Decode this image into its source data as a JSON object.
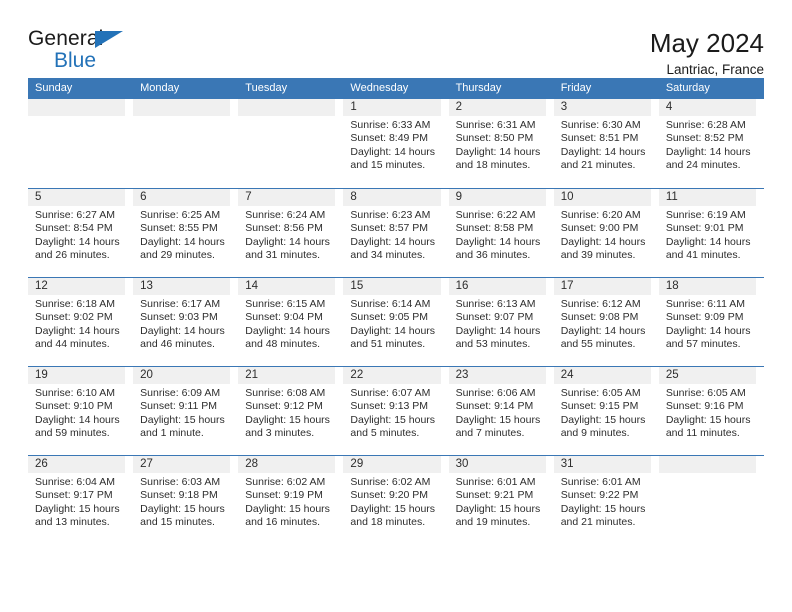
{
  "brand": {
    "name_top": "General",
    "name_bottom": "Blue",
    "accent_color": "#2372b8",
    "triangle_icon": "triangle-right-icon"
  },
  "header": {
    "title": "May 2024",
    "location": "Lantriac, France"
  },
  "calendar": {
    "header_color": "#3a77b5",
    "day_band_color": "#f0f0f0",
    "weekdays": [
      "Sunday",
      "Monday",
      "Tuesday",
      "Wednesday",
      "Thursday",
      "Friday",
      "Saturday"
    ],
    "weeks": [
      [
        {
          "day": "",
          "empty": true,
          "sunrise": "",
          "sunset": "",
          "daylight": ""
        },
        {
          "day": "",
          "empty": true,
          "sunrise": "",
          "sunset": "",
          "daylight": ""
        },
        {
          "day": "",
          "empty": true,
          "sunrise": "",
          "sunset": "",
          "daylight": ""
        },
        {
          "day": "1",
          "sunrise": "Sunrise: 6:33 AM",
          "sunset": "Sunset: 8:49 PM",
          "daylight": "Daylight: 14 hours and 15 minutes."
        },
        {
          "day": "2",
          "sunrise": "Sunrise: 6:31 AM",
          "sunset": "Sunset: 8:50 PM",
          "daylight": "Daylight: 14 hours and 18 minutes."
        },
        {
          "day": "3",
          "sunrise": "Sunrise: 6:30 AM",
          "sunset": "Sunset: 8:51 PM",
          "daylight": "Daylight: 14 hours and 21 minutes."
        },
        {
          "day": "4",
          "sunrise": "Sunrise: 6:28 AM",
          "sunset": "Sunset: 8:52 PM",
          "daylight": "Daylight: 14 hours and 24 minutes."
        }
      ],
      [
        {
          "day": "5",
          "sunrise": "Sunrise: 6:27 AM",
          "sunset": "Sunset: 8:54 PM",
          "daylight": "Daylight: 14 hours and 26 minutes."
        },
        {
          "day": "6",
          "sunrise": "Sunrise: 6:25 AM",
          "sunset": "Sunset: 8:55 PM",
          "daylight": "Daylight: 14 hours and 29 minutes."
        },
        {
          "day": "7",
          "sunrise": "Sunrise: 6:24 AM",
          "sunset": "Sunset: 8:56 PM",
          "daylight": "Daylight: 14 hours and 31 minutes."
        },
        {
          "day": "8",
          "sunrise": "Sunrise: 6:23 AM",
          "sunset": "Sunset: 8:57 PM",
          "daylight": "Daylight: 14 hours and 34 minutes."
        },
        {
          "day": "9",
          "sunrise": "Sunrise: 6:22 AM",
          "sunset": "Sunset: 8:58 PM",
          "daylight": "Daylight: 14 hours and 36 minutes."
        },
        {
          "day": "10",
          "sunrise": "Sunrise: 6:20 AM",
          "sunset": "Sunset: 9:00 PM",
          "daylight": "Daylight: 14 hours and 39 minutes."
        },
        {
          "day": "11",
          "sunrise": "Sunrise: 6:19 AM",
          "sunset": "Sunset: 9:01 PM",
          "daylight": "Daylight: 14 hours and 41 minutes."
        }
      ],
      [
        {
          "day": "12",
          "sunrise": "Sunrise: 6:18 AM",
          "sunset": "Sunset: 9:02 PM",
          "daylight": "Daylight: 14 hours and 44 minutes."
        },
        {
          "day": "13",
          "sunrise": "Sunrise: 6:17 AM",
          "sunset": "Sunset: 9:03 PM",
          "daylight": "Daylight: 14 hours and 46 minutes."
        },
        {
          "day": "14",
          "sunrise": "Sunrise: 6:15 AM",
          "sunset": "Sunset: 9:04 PM",
          "daylight": "Daylight: 14 hours and 48 minutes."
        },
        {
          "day": "15",
          "sunrise": "Sunrise: 6:14 AM",
          "sunset": "Sunset: 9:05 PM",
          "daylight": "Daylight: 14 hours and 51 minutes."
        },
        {
          "day": "16",
          "sunrise": "Sunrise: 6:13 AM",
          "sunset": "Sunset: 9:07 PM",
          "daylight": "Daylight: 14 hours and 53 minutes."
        },
        {
          "day": "17",
          "sunrise": "Sunrise: 6:12 AM",
          "sunset": "Sunset: 9:08 PM",
          "daylight": "Daylight: 14 hours and 55 minutes."
        },
        {
          "day": "18",
          "sunrise": "Sunrise: 6:11 AM",
          "sunset": "Sunset: 9:09 PM",
          "daylight": "Daylight: 14 hours and 57 minutes."
        }
      ],
      [
        {
          "day": "19",
          "sunrise": "Sunrise: 6:10 AM",
          "sunset": "Sunset: 9:10 PM",
          "daylight": "Daylight: 14 hours and 59 minutes."
        },
        {
          "day": "20",
          "sunrise": "Sunrise: 6:09 AM",
          "sunset": "Sunset: 9:11 PM",
          "daylight": "Daylight: 15 hours and 1 minute."
        },
        {
          "day": "21",
          "sunrise": "Sunrise: 6:08 AM",
          "sunset": "Sunset: 9:12 PM",
          "daylight": "Daylight: 15 hours and 3 minutes."
        },
        {
          "day": "22",
          "sunrise": "Sunrise: 6:07 AM",
          "sunset": "Sunset: 9:13 PM",
          "daylight": "Daylight: 15 hours and 5 minutes."
        },
        {
          "day": "23",
          "sunrise": "Sunrise: 6:06 AM",
          "sunset": "Sunset: 9:14 PM",
          "daylight": "Daylight: 15 hours and 7 minutes."
        },
        {
          "day": "24",
          "sunrise": "Sunrise: 6:05 AM",
          "sunset": "Sunset: 9:15 PM",
          "daylight": "Daylight: 15 hours and 9 minutes."
        },
        {
          "day": "25",
          "sunrise": "Sunrise: 6:05 AM",
          "sunset": "Sunset: 9:16 PM",
          "daylight": "Daylight: 15 hours and 11 minutes."
        }
      ],
      [
        {
          "day": "26",
          "sunrise": "Sunrise: 6:04 AM",
          "sunset": "Sunset: 9:17 PM",
          "daylight": "Daylight: 15 hours and 13 minutes."
        },
        {
          "day": "27",
          "sunrise": "Sunrise: 6:03 AM",
          "sunset": "Sunset: 9:18 PM",
          "daylight": "Daylight: 15 hours and 15 minutes."
        },
        {
          "day": "28",
          "sunrise": "Sunrise: 6:02 AM",
          "sunset": "Sunset: 9:19 PM",
          "daylight": "Daylight: 15 hours and 16 minutes."
        },
        {
          "day": "29",
          "sunrise": "Sunrise: 6:02 AM",
          "sunset": "Sunset: 9:20 PM",
          "daylight": "Daylight: 15 hours and 18 minutes."
        },
        {
          "day": "30",
          "sunrise": "Sunrise: 6:01 AM",
          "sunset": "Sunset: 9:21 PM",
          "daylight": "Daylight: 15 hours and 19 minutes."
        },
        {
          "day": "31",
          "sunrise": "Sunrise: 6:01 AM",
          "sunset": "Sunset: 9:22 PM",
          "daylight": "Daylight: 15 hours and 21 minutes."
        },
        {
          "day": "",
          "empty": true,
          "sunrise": "",
          "sunset": "",
          "daylight": ""
        }
      ]
    ]
  }
}
